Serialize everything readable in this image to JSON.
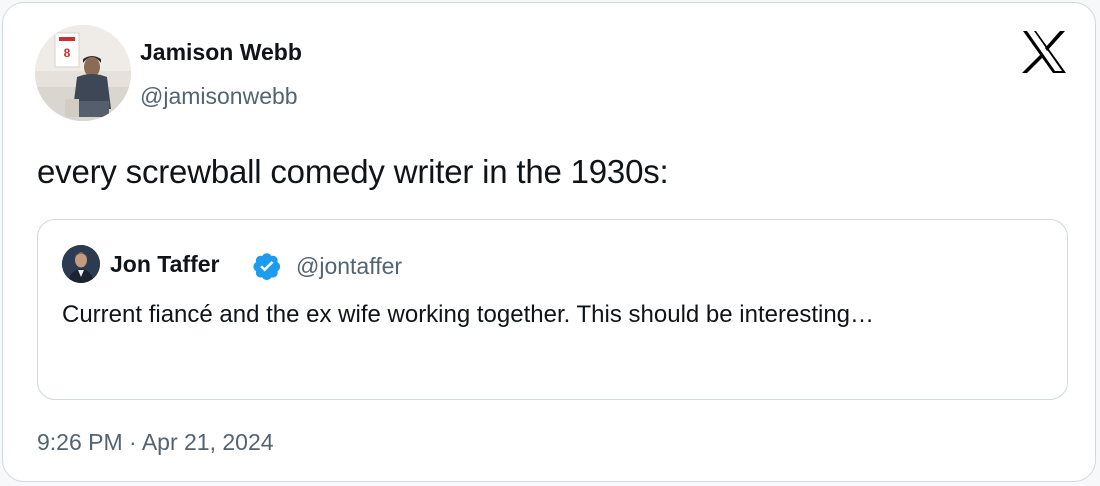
{
  "tweet": {
    "author": {
      "name": "Jamison Webb",
      "handle": "@jamisonwebb",
      "avatar_icon": "profile-photo"
    },
    "text": "every screwball comedy writer in the 1930s:",
    "timestamp": "9:26 PM · Apr 21, 2024",
    "brand_icon": "x-logo-icon"
  },
  "quoted_tweet": {
    "author": {
      "name": "Jon Taffer",
      "handle": "@jontaffer",
      "verified": true,
      "avatar_icon": "profile-photo"
    },
    "text": "Current fiancé and the ex wife working together. This should be interesting…"
  },
  "colors": {
    "text_primary": "#0f1419",
    "text_secondary": "#536471",
    "border": "#cfd9de",
    "verified_blue": "#1d9bf0"
  }
}
